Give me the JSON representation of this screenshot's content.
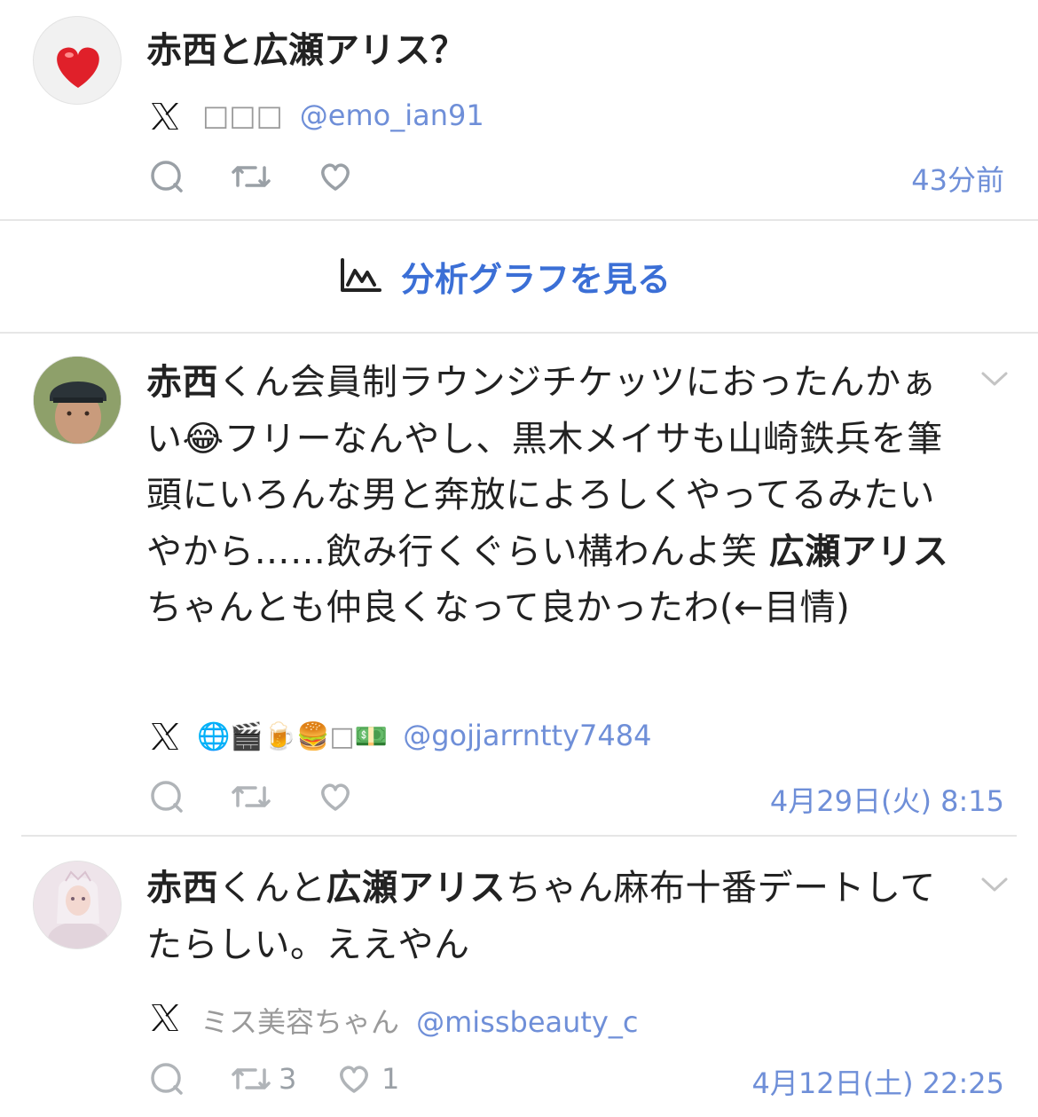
{
  "post1": {
    "title": "赤西と広瀬アリス？",
    "author_name": "□□□",
    "handle": "@emo_ian91",
    "time": "43分前"
  },
  "analytics": {
    "label": "分析グラフを見る"
  },
  "post2": {
    "segments": [
      {
        "text": "赤西",
        "bold": true
      },
      {
        "text": "くん会員制ラウンジチケッツにおったんかぁい😂フリーなんやし、黒木メイサも山崎鉄兵を筆頭にいろんな男と奔放によろしくやってるみたいやから……飲み行くぐらい構わんよ笑 ",
        "bold": false
      },
      {
        "text": "広瀬アリス",
        "bold": true
      },
      {
        "text": "ちゃんとも仲良くなって良かったわ(←目情)",
        "bold": false
      }
    ],
    "author_name": "🌐🎬🍺🍔□💵",
    "handle": "@gojjarrntty7484",
    "time": "4月29日(火) 8:15"
  },
  "post3": {
    "segments": [
      {
        "text": "赤西",
        "bold": true
      },
      {
        "text": "くんと",
        "bold": false
      },
      {
        "text": "広瀬アリス",
        "bold": true
      },
      {
        "text": "ちゃん麻布十番デートしてたらしい。ええやん",
        "bold": false
      }
    ],
    "author_name": "ミス美容ちゃん",
    "handle": "@missbeauty_c",
    "retweets": "3",
    "likes": "1",
    "time": "4月12日(土) 22:25"
  },
  "colors": {
    "link": "#3b6fd6",
    "meta_blue": "#6f8fd8",
    "gray": "#9aa0a6"
  }
}
